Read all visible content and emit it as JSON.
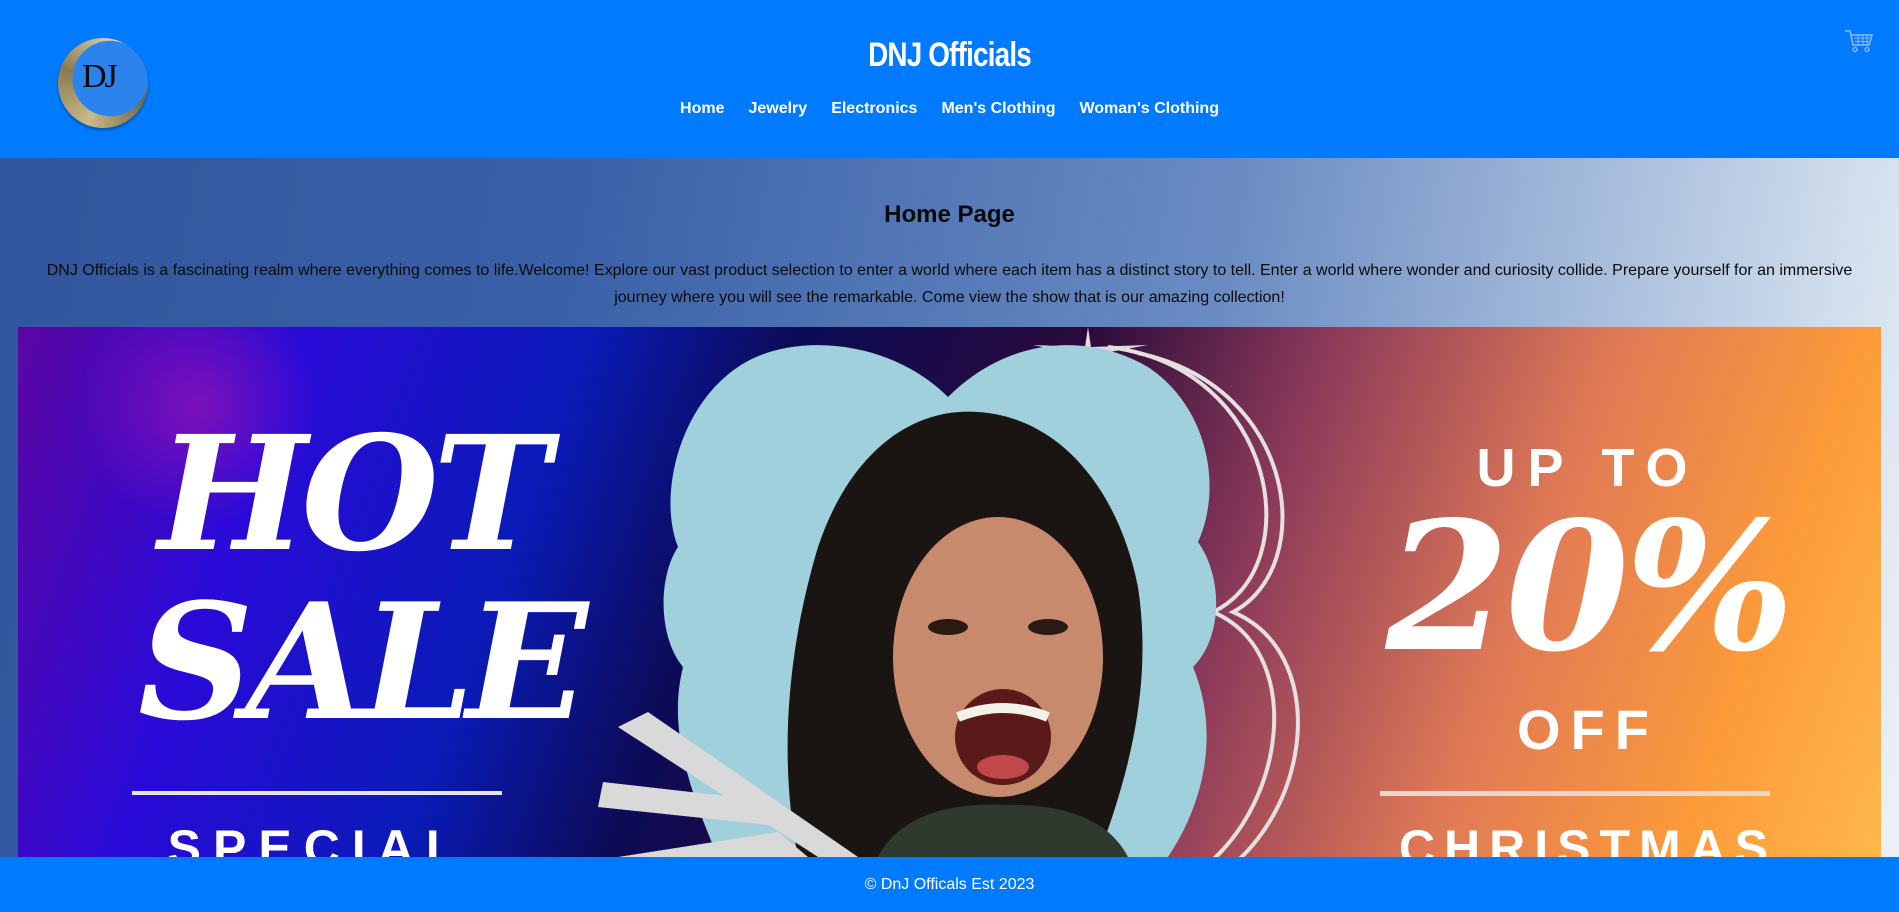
{
  "header": {
    "logo_text": "DJ",
    "brand": "DNJ Officials",
    "nav": [
      {
        "label": "Home"
      },
      {
        "label": "Jewelry"
      },
      {
        "label": "Electronics"
      },
      {
        "label": "Men's Clothing"
      },
      {
        "label": "Woman's Clothing"
      }
    ],
    "cart_icon": "shopping-cart-icon"
  },
  "main": {
    "title": "Home Page",
    "intro": "DNJ Officials is a fascinating realm where everything comes to life.Welcome! Explore our vast product selection to enter a world where each item has a distinct story to tell. Enter a world where wonder and curiosity collide. Prepare yourself for an immersive journey where you will see the remarkable. Come view the show that is our amazing collection!"
  },
  "banner": {
    "hot": "HOT",
    "sale": "SALE",
    "special_offer": "SPECIAL OFFER",
    "up_to": "UP TO",
    "percent": "20%",
    "off": "OFF",
    "christmas_offer": "CHRISTMAS OFFER"
  },
  "footer": {
    "text": "© DnJ Officals Est 2023"
  },
  "colors": {
    "header_bg": "#007bff",
    "footer_bg": "#007bff"
  }
}
